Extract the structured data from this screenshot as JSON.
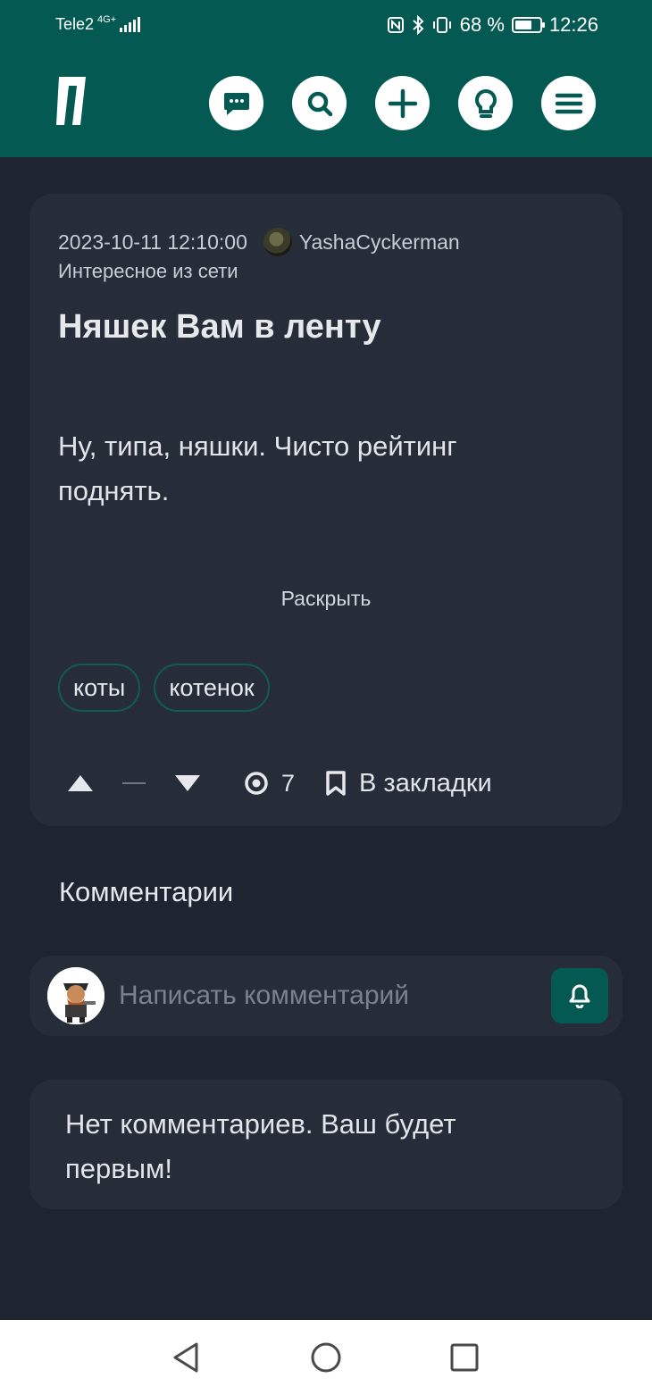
{
  "status_bar": {
    "carrier": "Tele2",
    "network": "4G+",
    "battery": "68 %",
    "battery_level": 0.68,
    "time": "12:26"
  },
  "header": {
    "logo_text": "П",
    "buttons": [
      {
        "icon": "chat-icon"
      },
      {
        "icon": "search-icon"
      },
      {
        "icon": "plus-icon"
      },
      {
        "icon": "lightbulb-icon"
      },
      {
        "icon": "menu-icon"
      }
    ]
  },
  "post": {
    "date": "2023-10-11 12:10:00",
    "author": "YashaCyckerman",
    "category": "Интересное из сети",
    "title": "Няшек Вам в ленту",
    "body": "Ну, типа, няшки. Чисто рейтинг поднять.",
    "expand_label": "Раскрыть",
    "tags": [
      "коты",
      "котенок"
    ],
    "rating_placeholder": "—",
    "views": "7",
    "bookmark_label": "В закладки"
  },
  "comments": {
    "heading": "Комментарии",
    "input_placeholder": "Написать комментарий",
    "empty_message": "Нет комментариев. Ваш будет первым!"
  },
  "colors": {
    "brand": "#045a52",
    "background": "#1e2530",
    "card": "#262d39"
  }
}
